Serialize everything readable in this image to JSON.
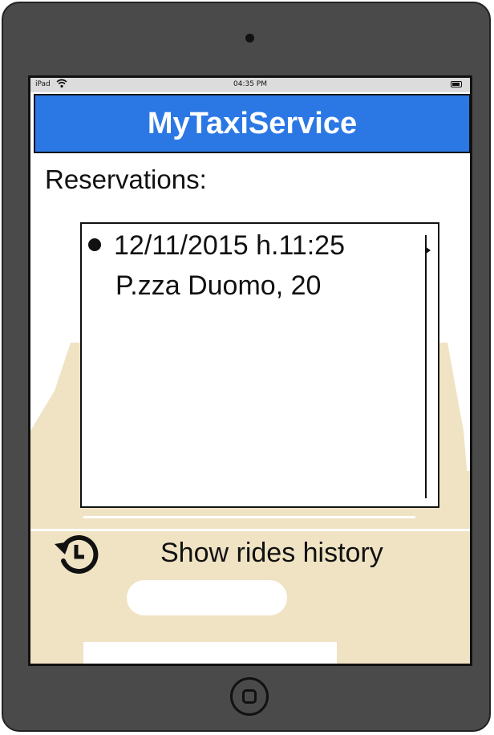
{
  "status_bar": {
    "carrier": "iPad",
    "time": "04:35 PM",
    "icons": [
      "wifi-icon",
      "battery-icon"
    ]
  },
  "header": {
    "title": "MyTaxiService",
    "color": "#2b78e4"
  },
  "reservations": {
    "label": "Reservations:",
    "items": [
      {
        "datetime": "12/11/2015 h.11:25",
        "address": "P.zza Duomo, 20"
      }
    ]
  },
  "history_button": {
    "label": "Show rides history",
    "icon": "history-icon"
  },
  "background": {
    "icon": "taxi-car-icon",
    "color": "#efe3c3"
  }
}
